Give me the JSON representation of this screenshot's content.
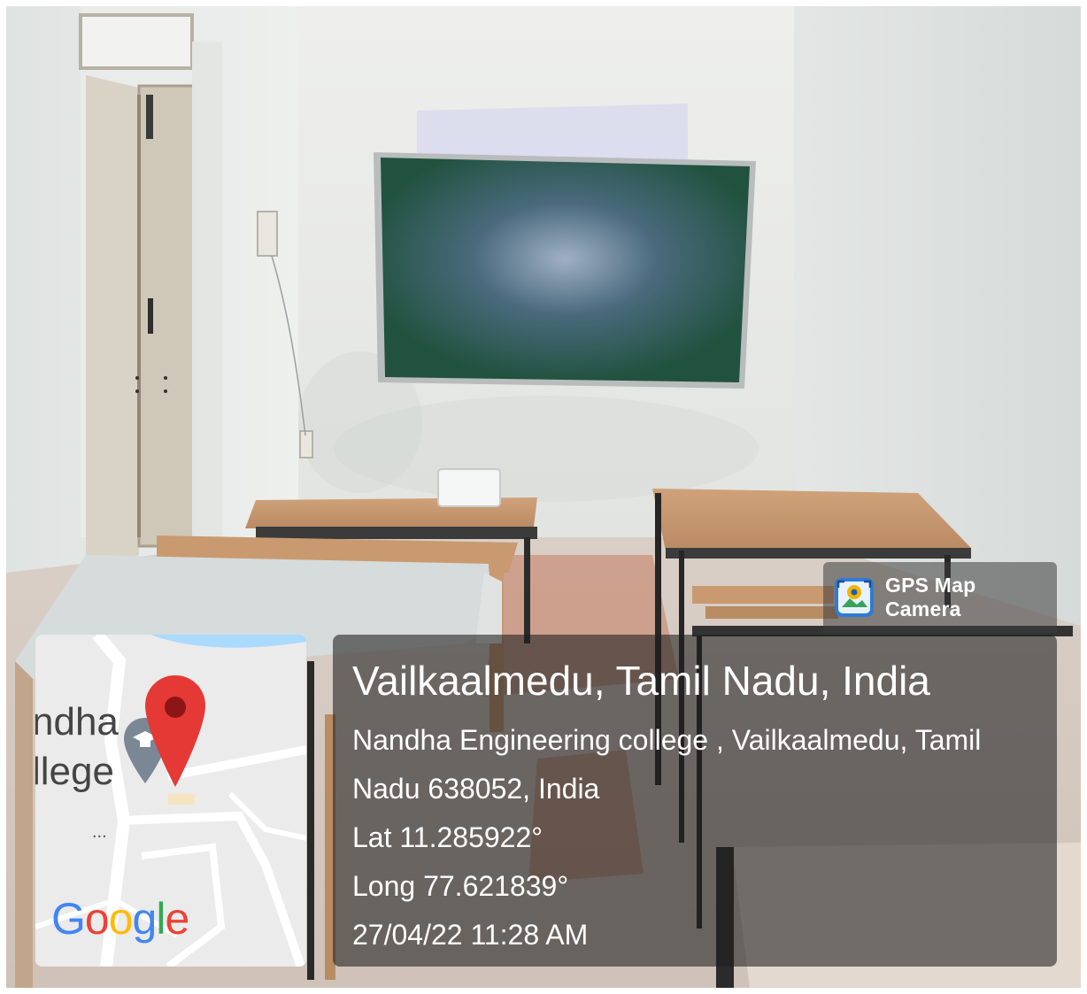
{
  "app_badge": {
    "label": "GPS Map Camera",
    "icon": "gps-map-camera-icon"
  },
  "map_thumbnail": {
    "place_label_line1": "ndha",
    "place_label_line2": "llege",
    "dots": "...",
    "logo_text": "Google",
    "pin_color": "#e53935",
    "college_marker_icon": "graduation-cap-pin-icon"
  },
  "location": {
    "title": "Vailkaalmedu, Tamil Nadu, India",
    "address_line1": "Nandha Engineering college , Vailkaalmedu, Tamil",
    "address_line2": "Nadu 638052, India",
    "latitude": "Lat 11.285922°",
    "longitude": "Long 77.621839°",
    "timestamp": "27/04/22 11:28 AM"
  }
}
